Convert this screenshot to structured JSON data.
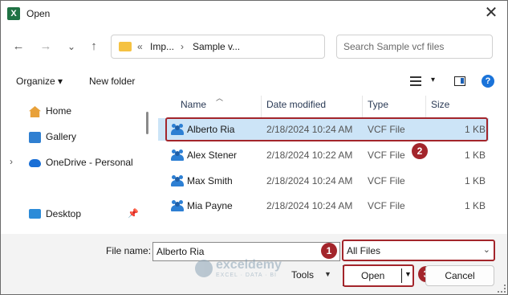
{
  "window": {
    "title": "Open",
    "app_icon": "excel-icon"
  },
  "nav": {
    "back": "←",
    "forward": "→",
    "recent": "⌄",
    "up": "↑",
    "address": {
      "overflow": "«",
      "segments": [
        "Imp...",
        "Sample v..."
      ],
      "sep": "›"
    },
    "search_placeholder": "Search Sample vcf files"
  },
  "toolbar": {
    "organize": "Organize ▾",
    "new_folder": "New folder",
    "view_caret": "▾",
    "help": "?"
  },
  "sidebar": {
    "items": [
      {
        "label": "Home",
        "icon": "home-icon"
      },
      {
        "label": "Gallery",
        "icon": "gallery-icon"
      },
      {
        "label": "OneDrive - Personal",
        "icon": "cloud-icon",
        "expand": "›"
      },
      {
        "label": "Desktop",
        "icon": "desktop-icon",
        "pinned": true
      }
    ]
  },
  "columns": {
    "name": "Name",
    "date": "Date modified",
    "type": "Type",
    "size": "Size"
  },
  "files": [
    {
      "name": "Alberto Ria",
      "date": "2/18/2024 10:24 AM",
      "type": "VCF File",
      "size": "1 KB",
      "selected": true
    },
    {
      "name": "Alex Stener",
      "date": "2/18/2024 10:22 AM",
      "type": "VCF File",
      "size": "1 KB"
    },
    {
      "name": "Max Smith",
      "date": "2/18/2024 10:24 AM",
      "type": "VCF File",
      "size": "1 KB"
    },
    {
      "name": "Mia Payne",
      "date": "2/18/2024 10:24 AM",
      "type": "VCF File",
      "size": "1 KB"
    }
  ],
  "bottom": {
    "file_name_label": "File name:",
    "file_name_value": "Alberto Ria",
    "filter_value": "All Files",
    "tools": "Tools",
    "open": "Open",
    "cancel": "Cancel"
  },
  "watermark": {
    "text": "exceldemy",
    "sub": "EXCEL · DATA · BI"
  },
  "annotations": [
    "1",
    "2",
    "3"
  ],
  "colors": {
    "annotation_red": "#a3252b",
    "selection": "#cce4f7",
    "accent": "#1a73d9"
  }
}
